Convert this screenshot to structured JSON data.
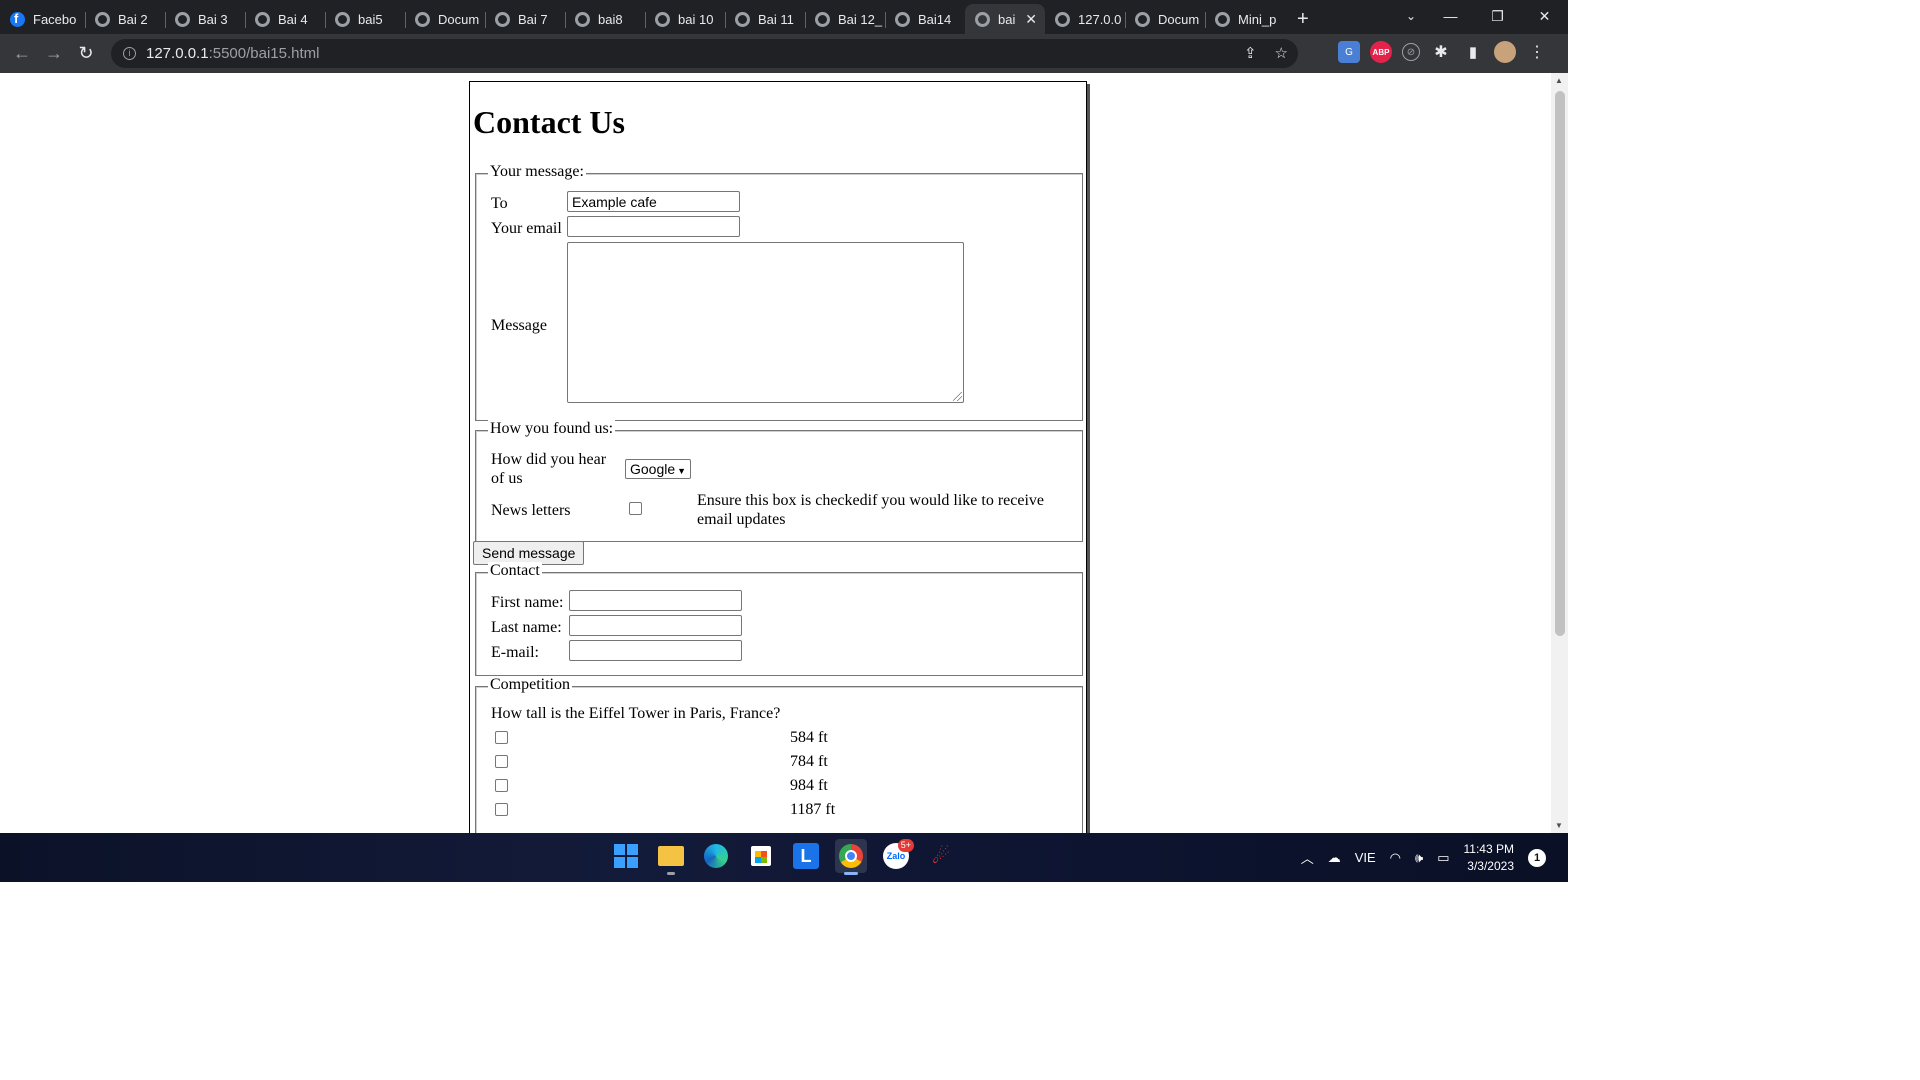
{
  "browser": {
    "tabs": [
      {
        "title": "Facebo",
        "icon": "facebook-icon"
      },
      {
        "title": "Bai 2",
        "icon": "globe-icon"
      },
      {
        "title": "Bai 3",
        "icon": "globe-icon"
      },
      {
        "title": "Bai 4",
        "icon": "globe-icon"
      },
      {
        "title": "bai5",
        "icon": "globe-icon"
      },
      {
        "title": "Docum",
        "icon": "globe-icon"
      },
      {
        "title": "Bai 7",
        "icon": "globe-icon"
      },
      {
        "title": "bai8",
        "icon": "globe-icon"
      },
      {
        "title": "bai 10",
        "icon": "globe-icon"
      },
      {
        "title": "Bai 11",
        "icon": "globe-icon"
      },
      {
        "title": "Bai 12_",
        "icon": "globe-icon"
      },
      {
        "title": "Bai14",
        "icon": "globe-icon"
      },
      {
        "title": "bai",
        "icon": "globe-icon",
        "active": true
      },
      {
        "title": "127.0.0",
        "icon": "globe-icon"
      },
      {
        "title": "Docum",
        "icon": "globe-icon"
      },
      {
        "title": "Mini_p",
        "icon": "globe-icon"
      }
    ],
    "url_host": "127.0.0.1",
    "url_path": ":5500/bai15.html"
  },
  "page": {
    "title": "Contact Us",
    "message_section": {
      "legend": "Your message:",
      "to_label": "To",
      "to_value": "Example cafe",
      "email_label": "Your email",
      "email_value": "",
      "message_label": "Message"
    },
    "found_section": {
      "legend": "How you found us:",
      "hear_label": "How did you hear of us",
      "hear_selected": "Google",
      "newsletter_label": "News letters",
      "newsletter_checked": false,
      "newsletter_note": "Ensure this box is checkedif you would like to receive email updates"
    },
    "send_button": "Send message",
    "contact_section": {
      "legend": "Contact",
      "first_name_label": "First name:",
      "last_name_label": "Last name:",
      "email_label": "E-mail:"
    },
    "competition_section": {
      "legend": "Competition",
      "question": "How tall is the Eiffel Tower in Paris, France?",
      "options": [
        "584 ft",
        "784 ft",
        "984 ft",
        "1187 ft"
      ]
    }
  },
  "taskbar": {
    "language": "VIE",
    "time": "11:43 PM",
    "date": "3/3/2023",
    "zalo_badge": "5+",
    "notification_count": "1"
  }
}
